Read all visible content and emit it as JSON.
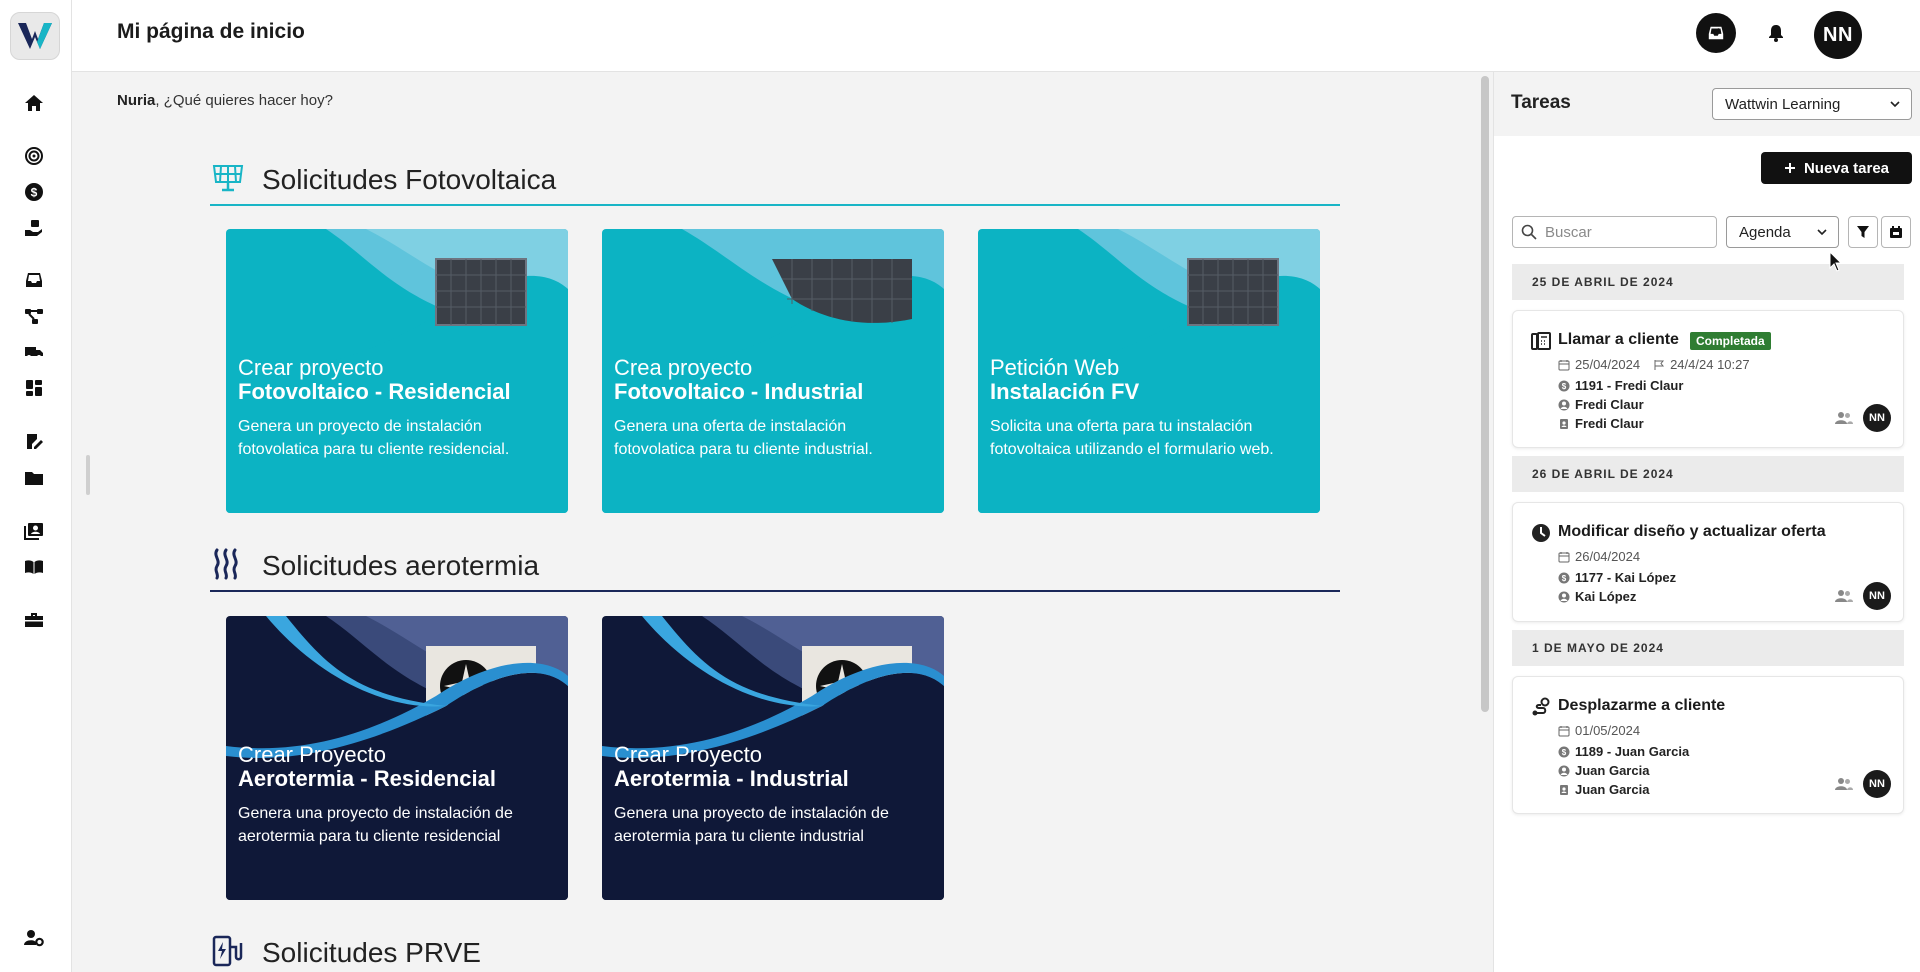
{
  "header": {
    "title": "Mi página de inicio",
    "avatar_initials": "NN"
  },
  "greeting": {
    "name": "Nuria",
    "text": ", ¿Qué quieres hacer hoy?"
  },
  "sidebar": {
    "icons": [
      "home-icon",
      "target-icon",
      "dollar-icon",
      "hand-icon",
      "inbox-icon",
      "flow-icon",
      "truck-icon",
      "dashboard-icon",
      "sign-icon",
      "folder-icon",
      "contacts-icon",
      "book-icon",
      "toolbox-icon",
      "user-settings-icon"
    ]
  },
  "sections": {
    "fv": {
      "title": "Solicitudes Fotovoltaica",
      "cards": [
        {
          "line1": "Crear proyecto",
          "line2": "Fotovoltaico - Residencial",
          "desc": "Genera un proyecto de instalación fotovolatica para tu cliente residencial."
        },
        {
          "line1": "Crea proyecto",
          "line2": "Fotovoltaico - Industrial",
          "desc": "Genera una oferta de instalación fotovolatica para tu cliente industrial."
        },
        {
          "line1": "Petición Web",
          "line2": "Instalación FV",
          "desc": "Solicita una oferta para tu instalación fotovoltaica utilizando el formulario web."
        }
      ]
    },
    "aero": {
      "title": "Solicitudes aerotermia",
      "cards": [
        {
          "line1": "Crear Proyecto",
          "line2": "Aerotermia - Residencial",
          "desc": "Genera una proyecto de instalación de aerotermia para tu cliente residencial"
        },
        {
          "line1": "Crear Proyecto",
          "line2": "Aerotermia - Industrial",
          "desc": "Genera una proyecto de instalación de aerotermia para tu cliente industrial"
        }
      ]
    },
    "prve": {
      "title": "Solicitudes PRVE"
    }
  },
  "tasks": {
    "title": "Tareas",
    "org_select": "Wattwin Learning",
    "new_task_label": "Nueva tarea",
    "search_placeholder": "Buscar",
    "view_select": "Agenda",
    "groups": [
      {
        "date": "25 DE ABRIL DE 2024",
        "task": {
          "title": "Llamar a cliente",
          "badge": "Completada",
          "date": "25/04/2024",
          "deadline": "24/4/24 10:27",
          "project": "1191 - Fredi Claur",
          "contact": "Fredi Claur",
          "client": "Fredi Claur",
          "assignee": "NN"
        }
      },
      {
        "date": "26 DE ABRIL DE 2024",
        "task": {
          "title": "Modificar diseño y actualizar oferta",
          "date": "26/04/2024",
          "project": "1177 - Kai López",
          "contact": "Kai López",
          "assignee": "NN"
        }
      },
      {
        "date": "1 DE MAYO DE 2024",
        "task": {
          "title": "Desplazarme a cliente",
          "date": "01/05/2024",
          "project": "1189 - Juan Garcia",
          "contact": "Juan Garcia",
          "client": "Juan Garcia",
          "assignee": "NN"
        }
      }
    ]
  },
  "colors": {
    "accent_teal": "#0cb3c3",
    "navy": "#0f1838",
    "badge_green": "#2f7d32",
    "dark": "#111111"
  }
}
